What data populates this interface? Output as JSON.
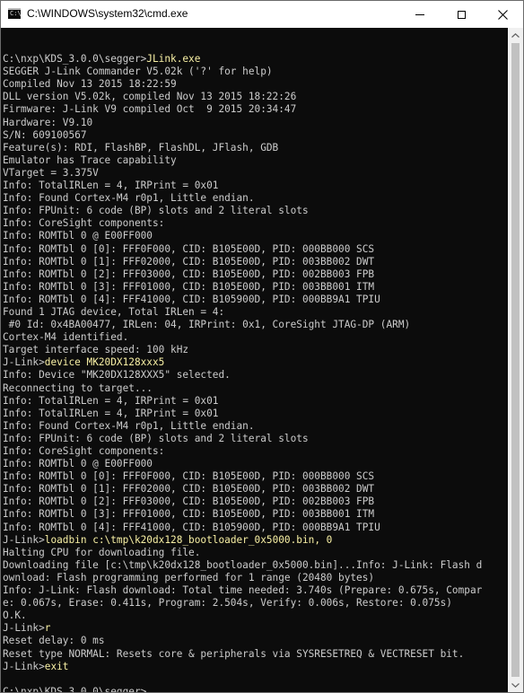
{
  "window": {
    "title": "C:\\WINDOWS\\system32\\cmd.exe",
    "icon": "cmd-app-icon",
    "controls": {
      "minimize_icon": "minimize-icon",
      "maximize_icon": "maximize-icon",
      "close_icon": "close-icon",
      "close_glyph": "✕"
    }
  },
  "colors": {
    "console_background": "#0c0c0c",
    "output_text": "#cccccc",
    "command_text": "#f9f1a5",
    "scrollbar_track": "#f0f0f0",
    "scrollbar_thumb": "#c1c1c1"
  },
  "console": {
    "lines": [
      {
        "text": "",
        "cmd": ""
      },
      {
        "text": "C:\\nxp\\KDS_3.0.0\\segger>",
        "cmd": "JLink.exe"
      },
      {
        "text": "SEGGER J-Link Commander V5.02k ('?' for help)",
        "cmd": ""
      },
      {
        "text": "Compiled Nov 13 2015 18:22:59",
        "cmd": ""
      },
      {
        "text": "DLL version V5.02k, compiled Nov 13 2015 18:22:26",
        "cmd": ""
      },
      {
        "text": "Firmware: J-Link V9 compiled Oct  9 2015 20:34:47",
        "cmd": ""
      },
      {
        "text": "Hardware: V9.10",
        "cmd": ""
      },
      {
        "text": "S/N: 609100567",
        "cmd": ""
      },
      {
        "text": "Feature(s): RDI, FlashBP, FlashDL, JFlash, GDB",
        "cmd": ""
      },
      {
        "text": "Emulator has Trace capability",
        "cmd": ""
      },
      {
        "text": "VTarget = 3.375V",
        "cmd": ""
      },
      {
        "text": "Info: TotalIRLen = 4, IRPrint = 0x01",
        "cmd": ""
      },
      {
        "text": "Info: Found Cortex-M4 r0p1, Little endian.",
        "cmd": ""
      },
      {
        "text": "Info: FPUnit: 6 code (BP) slots and 2 literal slots",
        "cmd": ""
      },
      {
        "text": "Info: CoreSight components:",
        "cmd": ""
      },
      {
        "text": "Info: ROMTbl 0 @ E00FF000",
        "cmd": ""
      },
      {
        "text": "Info: ROMTbl 0 [0]: FFF0F000, CID: B105E00D, PID: 000BB000 SCS",
        "cmd": ""
      },
      {
        "text": "Info: ROMTbl 0 [1]: FFF02000, CID: B105E00D, PID: 003BB002 DWT",
        "cmd": ""
      },
      {
        "text": "Info: ROMTbl 0 [2]: FFF03000, CID: B105E00D, PID: 002BB003 FPB",
        "cmd": ""
      },
      {
        "text": "Info: ROMTbl 0 [3]: FFF01000, CID: B105E00D, PID: 003BB001 ITM",
        "cmd": ""
      },
      {
        "text": "Info: ROMTbl 0 [4]: FFF41000, CID: B105900D, PID: 000BB9A1 TPIU",
        "cmd": ""
      },
      {
        "text": "Found 1 JTAG device, Total IRLen = 4:",
        "cmd": ""
      },
      {
        "text": " #0 Id: 0x4BA00477, IRLen: 04, IRPrint: 0x1, CoreSight JTAG-DP (ARM)",
        "cmd": ""
      },
      {
        "text": "Cortex-M4 identified.",
        "cmd": ""
      },
      {
        "text": "Target interface speed: 100 kHz",
        "cmd": ""
      },
      {
        "text": "J-Link>",
        "cmd": "device MK20DX128xxx5"
      },
      {
        "text": "Info: Device \"MK20DX128XXX5\" selected.",
        "cmd": ""
      },
      {
        "text": "Reconnecting to target...",
        "cmd": ""
      },
      {
        "text": "Info: TotalIRLen = 4, IRPrint = 0x01",
        "cmd": ""
      },
      {
        "text": "Info: TotalIRLen = 4, IRPrint = 0x01",
        "cmd": ""
      },
      {
        "text": "Info: Found Cortex-M4 r0p1, Little endian.",
        "cmd": ""
      },
      {
        "text": "Info: FPUnit: 6 code (BP) slots and 2 literal slots",
        "cmd": ""
      },
      {
        "text": "Info: CoreSight components:",
        "cmd": ""
      },
      {
        "text": "Info: ROMTbl 0 @ E00FF000",
        "cmd": ""
      },
      {
        "text": "Info: ROMTbl 0 [0]: FFF0F000, CID: B105E00D, PID: 000BB000 SCS",
        "cmd": ""
      },
      {
        "text": "Info: ROMTbl 0 [1]: FFF02000, CID: B105E00D, PID: 003BB002 DWT",
        "cmd": ""
      },
      {
        "text": "Info: ROMTbl 0 [2]: FFF03000, CID: B105E00D, PID: 002BB003 FPB",
        "cmd": ""
      },
      {
        "text": "Info: ROMTbl 0 [3]: FFF01000, CID: B105E00D, PID: 003BB001 ITM",
        "cmd": ""
      },
      {
        "text": "Info: ROMTbl 0 [4]: FFF41000, CID: B105900D, PID: 000BB9A1 TPIU",
        "cmd": ""
      },
      {
        "text": "J-Link>",
        "cmd": "loadbin c:\\tmp\\k20dx128_bootloader_0x5000.bin, 0"
      },
      {
        "text": "Halting CPU for downloading file.",
        "cmd": ""
      },
      {
        "text": "Downloading file [c:\\tmp\\k20dx128_bootloader_0x5000.bin]...Info: J-Link: Flash d",
        "cmd": ""
      },
      {
        "text": "ownload: Flash programming performed for 1 range (20480 bytes)",
        "cmd": ""
      },
      {
        "text": "Info: J-Link: Flash download: Total time needed: 3.740s (Prepare: 0.675s, Compar",
        "cmd": ""
      },
      {
        "text": "e: 0.067s, Erase: 0.411s, Program: 2.504s, Verify: 0.006s, Restore: 0.075s)",
        "cmd": ""
      },
      {
        "text": "O.K.",
        "cmd": ""
      },
      {
        "text": "J-Link>",
        "cmd": "r"
      },
      {
        "text": "Reset delay: 0 ms",
        "cmd": ""
      },
      {
        "text": "Reset type NORMAL: Resets core & peripherals via SYSRESETREQ & VECTRESET bit.",
        "cmd": ""
      },
      {
        "text": "J-Link>",
        "cmd": "exit"
      },
      {
        "text": "",
        "cmd": ""
      },
      {
        "text": "C:\\nxp\\KDS_3.0.0\\segger>",
        "cmd": "",
        "cursor": true
      }
    ]
  }
}
